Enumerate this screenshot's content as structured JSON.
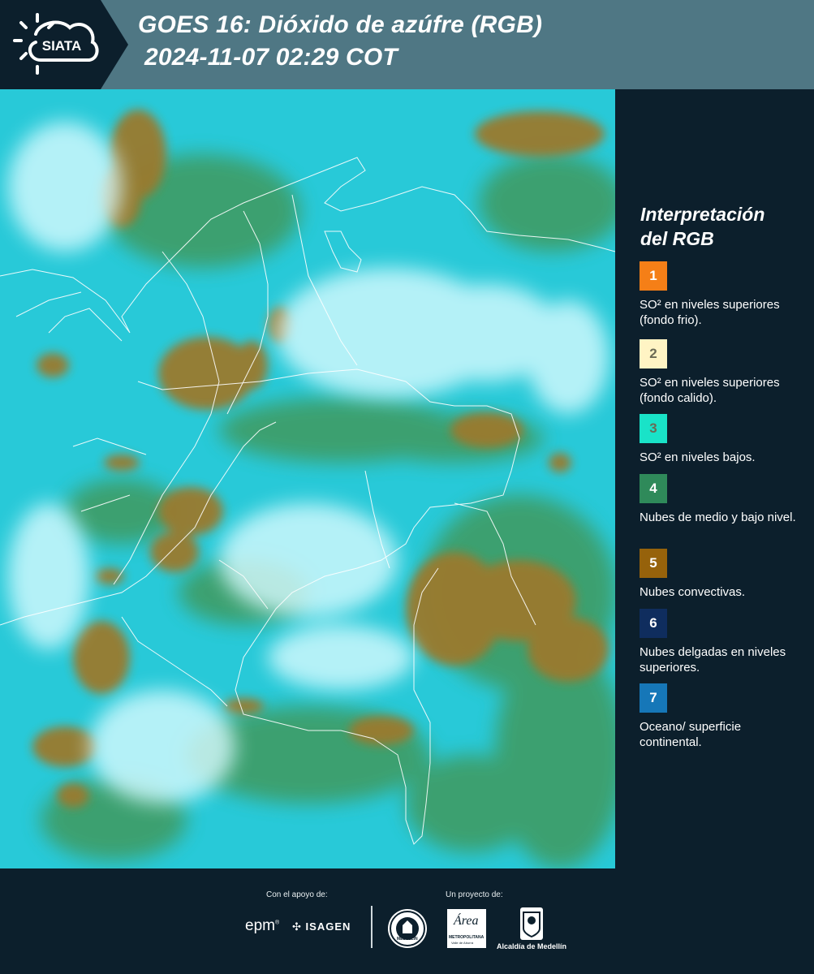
{
  "header": {
    "logo_text": "SIATA",
    "title_line1": "GOES 16: Dióxido de azúfre (RGB)",
    "title_line2": "2024-11-07 02:29 COT"
  },
  "legend": {
    "title_line1": "Interpretación",
    "title_line2": "del RGB",
    "items": [
      {
        "number": "1",
        "color": "#f57f17",
        "text": "SO² en niveles superiores (fondo frio)."
      },
      {
        "number": "2",
        "color": "#fff4c4",
        "text": "SO² en niveles superiores (fondo calido)."
      },
      {
        "number": "3",
        "color": "#19e3c8",
        "text": "SO² en niveles bajos."
      },
      {
        "number": "4",
        "color": "#2f8a5a",
        "text": "Nubes de medio y bajo nivel."
      },
      {
        "number": "5",
        "color": "#96620b",
        "text": "Nubes convectivas."
      },
      {
        "number": "6",
        "color": "#0f2d5e",
        "text": "Nubes delgadas en niveles superiores."
      },
      {
        "number": "7",
        "color": "#1677b8",
        "text": "Oceano/ superficie continental."
      }
    ]
  },
  "map": {
    "colors": {
      "ocean_cyan": "#28c9d8",
      "convective_brown": "#9a7a2e",
      "midlevel_green": "#3f9a5e",
      "high_cloud_white": "#d8fbff",
      "borders": "#ffffff"
    }
  },
  "footer": {
    "support_label": "Con el apoyo de:",
    "project_label": "Un proyecto de:",
    "sponsor_epm": "epm",
    "sponsor_isagen": "ISAGEN",
    "seal_medellin_label": "MEDELLÍN",
    "area_metropolitana": "Área",
    "area_subtitle": "METROPOLITANA",
    "area_subtitle2": "Valle de Aburrá",
    "alcaldia": "Alcaldía de Medellín"
  }
}
